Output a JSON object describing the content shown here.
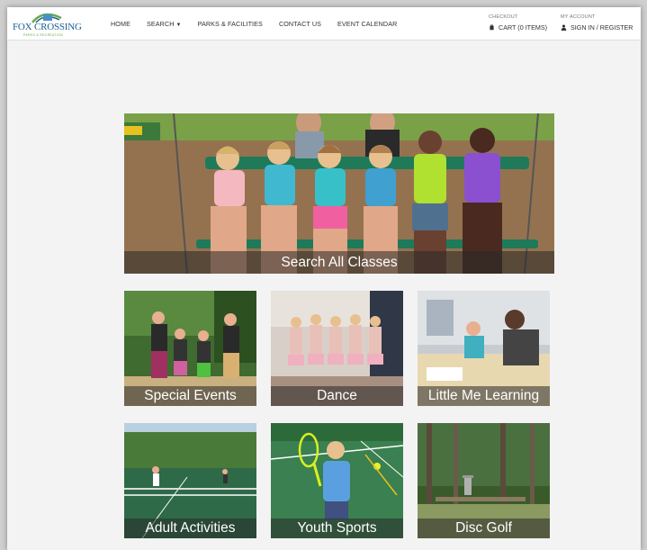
{
  "header": {
    "logo": {
      "name": "FOX CROSSING",
      "subtitle": "PARKS & RECREATION"
    },
    "nav": [
      {
        "label": "HOME"
      },
      {
        "label": "SEARCH"
      },
      {
        "label": "PARKS & FACILITIES"
      },
      {
        "label": "CONTACT US"
      },
      {
        "label": "EVENT CALENDAR"
      }
    ],
    "checkout": {
      "label": "CHECKOUT",
      "link": "CART (0 ITEMS)",
      "icon": "cart-icon"
    },
    "account": {
      "label": "MY ACCOUNT",
      "link": "SIGN IN / REGISTER",
      "icon": "user-icon"
    }
  },
  "hero": {
    "label": "Search All Classes"
  },
  "tiles": [
    {
      "label": "Special Events"
    },
    {
      "label": "Dance"
    },
    {
      "label": "Little Me Learning"
    },
    {
      "label": "Adult Activities"
    },
    {
      "label": "Youth Sports"
    },
    {
      "label": "Disc Golf"
    }
  ],
  "colors": {
    "brand_blue": "#1c5f8f",
    "brand_green": "#6aa84f",
    "label_overlay": "rgba(40,40,40,0.55)"
  }
}
